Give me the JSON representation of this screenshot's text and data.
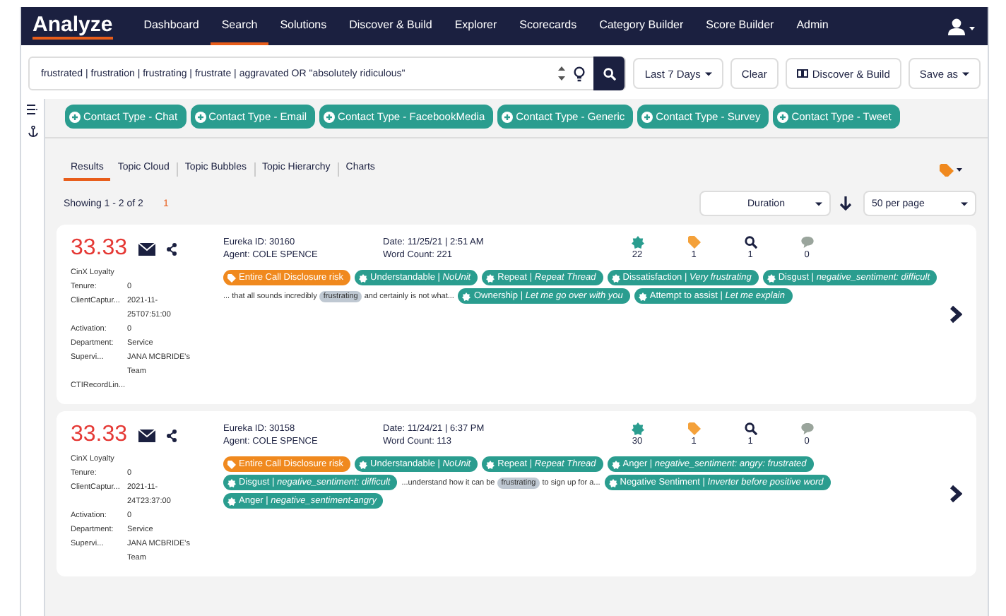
{
  "nav": {
    "logo": "Analyze",
    "items": [
      {
        "label": "Dashboard",
        "selected": false
      },
      {
        "label": "Search",
        "selected": true
      },
      {
        "label": "Solutions",
        "selected": false
      },
      {
        "label": "Discover & Build",
        "selected": false
      },
      {
        "label": "Explorer",
        "selected": false
      },
      {
        "label": "Scorecards",
        "selected": false
      },
      {
        "label": "Category Builder",
        "selected": false
      },
      {
        "label": "Score Builder",
        "selected": false
      },
      {
        "label": "Admin",
        "selected": false
      }
    ]
  },
  "search": {
    "value": "frustrated | frustration | frustrating | frustrate | aggravated OR \"absolutely ridiculous\"",
    "date_range": "Last 7 Days",
    "clear": "Clear",
    "discover": "Discover & Build",
    "save": "Save as"
  },
  "filters": [
    "Contact Type - Chat",
    "Contact Type - Email",
    "Contact Type - FacebookMedia",
    "Contact Type - Generic",
    "Contact Type - Survey",
    "Contact Type - Tweet"
  ],
  "tabs": [
    {
      "label": "Results",
      "selected": true
    },
    {
      "label": "Topic Cloud",
      "selected": false
    },
    {
      "label": "Topic Bubbles",
      "selected": false
    },
    {
      "label": "Topic Hierarchy",
      "selected": false
    },
    {
      "label": "Charts",
      "selected": false
    }
  ],
  "showing": "Showing 1 - 2 of 2",
  "page": "1",
  "sort": "Duration",
  "per_page": "50 per page",
  "results": [
    {
      "score": "33.33",
      "meta": [
        {
          "label": "CinX Loyalty"
        },
        {
          "label": "Tenure:",
          "value": "0"
        },
        {
          "label": "ClientCaptur...",
          "value": "2021-11-25T07:51:00"
        },
        {
          "label": "Activation:",
          "value": "0"
        },
        {
          "label": "Department:",
          "value": "Service"
        },
        {
          "label": "Supervi...",
          "value": "JANA MCBRIDE's Team"
        },
        {
          "label": "CTIRecordLin..."
        }
      ],
      "eureka_id": "Eureka ID: 30160",
      "agent": "Agent: COLE SPENCE",
      "date": "Date: 11/25/21 | 2:51 AM",
      "word_count": "Word Count: 221",
      "stats": [
        "22",
        "1",
        "1",
        "0"
      ],
      "tags": [
        {
          "kind": "risk",
          "text": "Entire Call Disclosure risk"
        },
        {
          "kind": "tag",
          "text": "Understandable | *NoUnit*"
        },
        {
          "kind": "tag",
          "text": "Repeat | *Repeat Thread*"
        },
        {
          "kind": "tag",
          "text": "Dissatisfaction | *Very frustrating*"
        },
        {
          "kind": "tag",
          "text": "Disgust | *negative_sentiment: difficult*"
        },
        {
          "kind": "snippet",
          "before": "... that all sounds incredibly",
          "match": "frustrating",
          "after": "and certainly is not what..."
        },
        {
          "kind": "tag",
          "text": "Ownership | *Let me go over with you*"
        },
        {
          "kind": "tag",
          "text": "Attempt to assist | *Let me explain*"
        }
      ]
    },
    {
      "score": "33.33",
      "meta": [
        {
          "label": "CinX Loyalty"
        },
        {
          "label": "Tenure:",
          "value": "0"
        },
        {
          "label": "ClientCaptur...",
          "value": "2021-11-24T23:37:00"
        },
        {
          "label": "Activation:",
          "value": "0"
        },
        {
          "label": "Department:",
          "value": "Service"
        },
        {
          "label": "Supervi...",
          "value": "JANA MCBRIDE's Team"
        }
      ],
      "eureka_id": "Eureka ID: 30158",
      "agent": "Agent: COLE SPENCE",
      "date": "Date: 11/24/21 | 6:37 PM",
      "word_count": "Word Count: 113",
      "stats": [
        "30",
        "1",
        "1",
        "0"
      ],
      "tags": [
        {
          "kind": "risk",
          "text": "Entire Call Disclosure risk"
        },
        {
          "kind": "tag",
          "text": "Understandable | *NoUnit*"
        },
        {
          "kind": "tag",
          "text": "Repeat | *Repeat Thread*"
        },
        {
          "kind": "tag",
          "text": "Anger | *negative_sentiment: angry: frustrated*"
        },
        {
          "kind": "tag",
          "text": "Disgust | *negative_sentiment: difficult*"
        },
        {
          "kind": "snippet",
          "before": "...understand how it can be",
          "match": "frustrating",
          "after": "to sign up for a..."
        },
        {
          "kind": "tag",
          "text": "Negative Sentiment | *Inverter before positive word*"
        },
        {
          "kind": "tag",
          "text": "Anger | *negative_sentiment-angry*"
        }
      ]
    }
  ]
}
